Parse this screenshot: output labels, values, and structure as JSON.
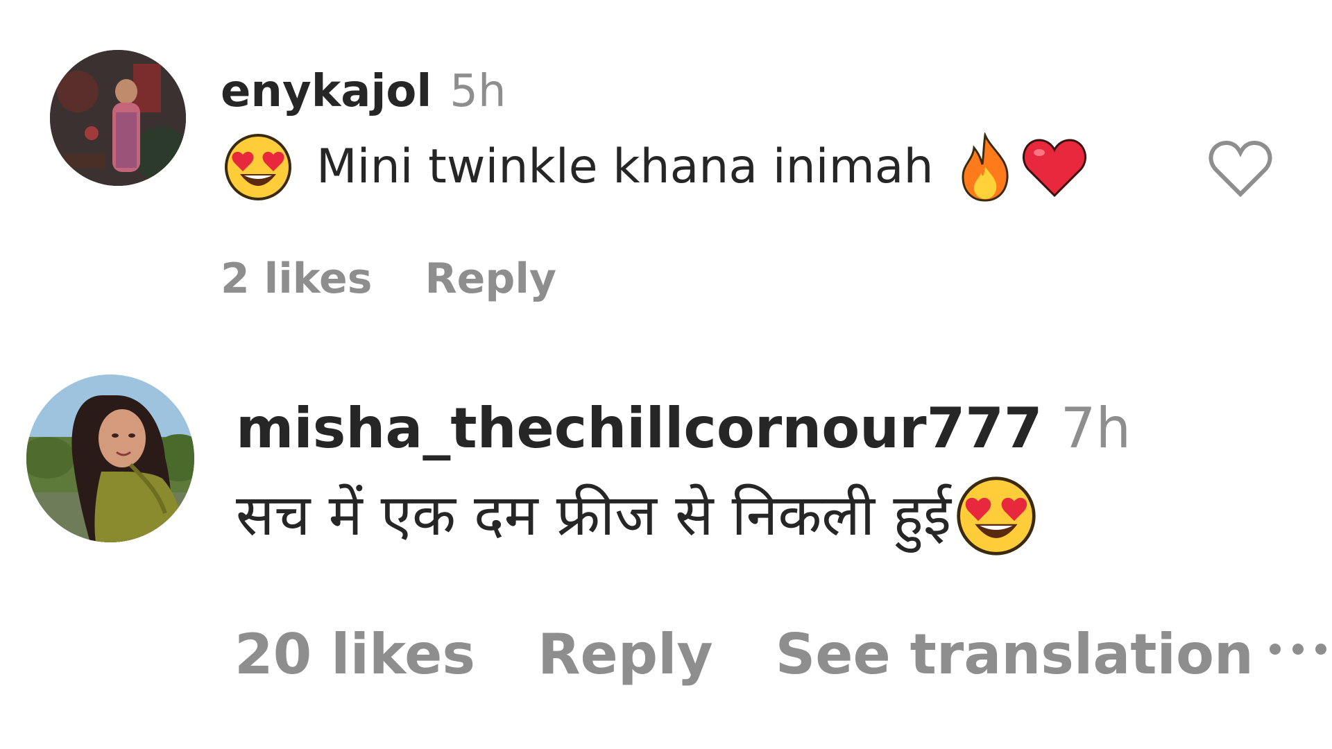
{
  "comments": [
    {
      "username": "enykajol",
      "time": "5h",
      "text": "Mini twinkle khana inimah",
      "emojis_before": [
        "heart-eyes-face"
      ],
      "emojis_after": [
        "fire",
        "red-heart"
      ],
      "likes": "2 likes",
      "reply": "Reply"
    },
    {
      "username": "misha_thechillcornour777",
      "time": "7h",
      "text": "सच में एक दम फ्रीज से निकली हुई",
      "emojis_after": [
        "heart-eyes-face"
      ],
      "likes": "20 likes",
      "reply": "Reply",
      "see_translation": "See translation"
    }
  ],
  "icons": {
    "like": "heart-outline-icon",
    "more": "more-options-icon"
  },
  "colors": {
    "text": "#262626",
    "muted": "#8e8e8e",
    "emoji_face": "#ffcc3a",
    "emoji_heart": "#e8283c",
    "emoji_fire": "#ff7a1a"
  }
}
